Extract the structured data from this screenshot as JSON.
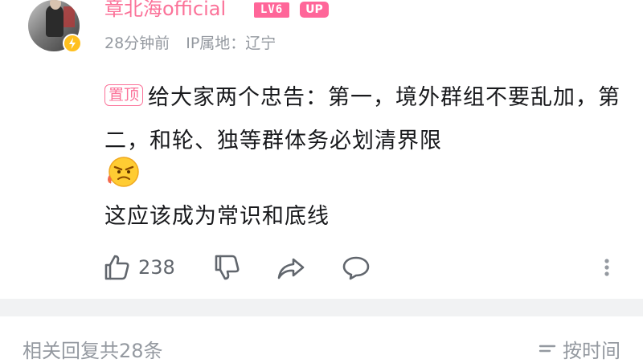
{
  "comment": {
    "username": "章北海official",
    "level_badge": "LV6",
    "up_badge": "UP",
    "time": "28分钟前",
    "ip_location": "IP属地：辽宁",
    "pinned_label": "置顶",
    "text": "给大家两个忠告：第一，境外群组不要乱加，第二，和轮、独等群体务必划清界限",
    "emoji": "angry-face-emoji",
    "text_line2": "这应该成为常识和底线",
    "like_count": "238"
  },
  "footer": {
    "related_replies": "相关回复共28条",
    "sort_label": "按时间"
  },
  "icons": {
    "like": "thumbs-up-icon",
    "dislike": "thumbs-down-icon",
    "share": "share-icon",
    "reply": "reply-bubble-icon",
    "more": "more-vertical-icon"
  },
  "colors": {
    "username": "#fb7299",
    "badge": "#ff6699",
    "meta": "#9499a0",
    "text": "#18191c",
    "divider": "#f1f2f3",
    "vip_badge": "#ffc01f"
  }
}
